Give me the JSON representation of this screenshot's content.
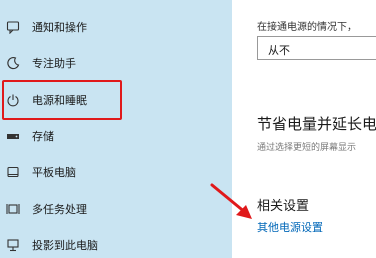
{
  "sidebar": {
    "items": [
      {
        "label": "通知和操作",
        "icon": "notification-icon"
      },
      {
        "label": "专注助手",
        "icon": "moon-icon"
      },
      {
        "label": "电源和睡眠",
        "icon": "power-icon"
      },
      {
        "label": "存储",
        "icon": "storage-icon"
      },
      {
        "label": "平板电脑",
        "icon": "tablet-icon"
      },
      {
        "label": "多任务处理",
        "icon": "multitasking-icon"
      },
      {
        "label": "投影到此电脑",
        "icon": "project-icon"
      }
    ]
  },
  "content": {
    "plugged_in_text": "在接通电源的情况下，",
    "sleep_dropdown_value": "从不",
    "save_energy_title": "节省电量并延长电",
    "save_energy_desc": "通过选择更短的屏幕显示",
    "related_title": "相关设置",
    "other_power_link": "其他电源设置"
  },
  "colors": {
    "sidebar_bg": "#c9e4f2",
    "highlight": "#e0191b",
    "link": "#0067b8",
    "arrow": "#e0191b"
  }
}
